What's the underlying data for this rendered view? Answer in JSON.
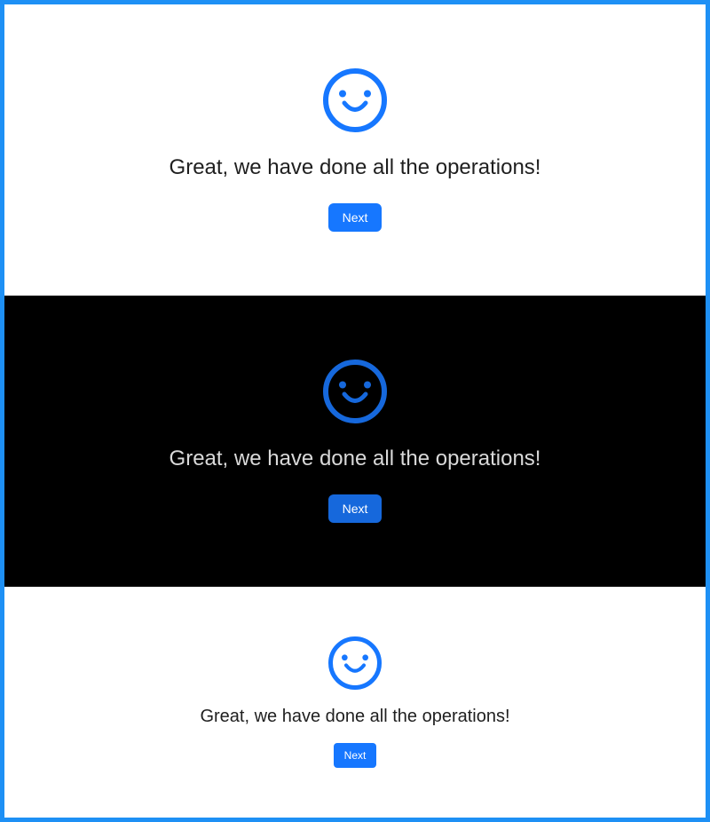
{
  "colors": {
    "frame": "#1e90f5",
    "primary": "#1677ff",
    "primary_dark": "#1668dc"
  },
  "panels": [
    {
      "theme": "light",
      "icon": "smile-icon",
      "title": "Great, we have done all the operations!",
      "button_label": "Next"
    },
    {
      "theme": "dark",
      "icon": "smile-icon",
      "title": "Great, we have done all the operations!",
      "button_label": "Next"
    },
    {
      "theme": "light-small",
      "icon": "smile-icon",
      "title": "Great, we have done all the operations!",
      "button_label": "Next"
    }
  ]
}
